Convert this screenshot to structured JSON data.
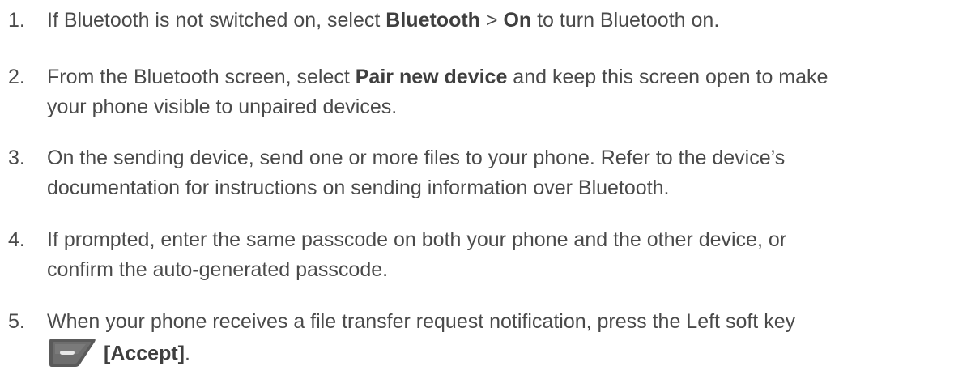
{
  "steps": [
    {
      "number": "1.",
      "before": "If Bluetooth is not switched on, select ",
      "bold1": "Bluetooth",
      "sep": " > ",
      "bold2": "On",
      "after": " to turn Bluetooth on."
    },
    {
      "number": "2.",
      "before": "From the Bluetooth screen, select ",
      "bold": "Pair new device",
      "after": " and keep this screen open to make",
      "line2": "your phone visible to unpaired devices."
    },
    {
      "number": "3.",
      "line1": "On the sending device, send one or more files to your phone. Refer to the device’s",
      "line2": "documentation for instructions on sending information over Bluetooth."
    },
    {
      "number": "4.",
      "line1": "If prompted, enter the same passcode on both your phone and the other device, or",
      "line2": "confirm the auto-generated passcode."
    },
    {
      "number": "5.",
      "line1": "When your phone receives a file transfer request notification, press the Left soft key",
      "softkey_icon": "left-soft-key-icon",
      "bold": "[Accept]",
      "after": "."
    }
  ],
  "colors": {
    "text": "#4a4a4a",
    "icon_dark": "#5a5a5a",
    "icon_light": "#e8e8e8"
  }
}
